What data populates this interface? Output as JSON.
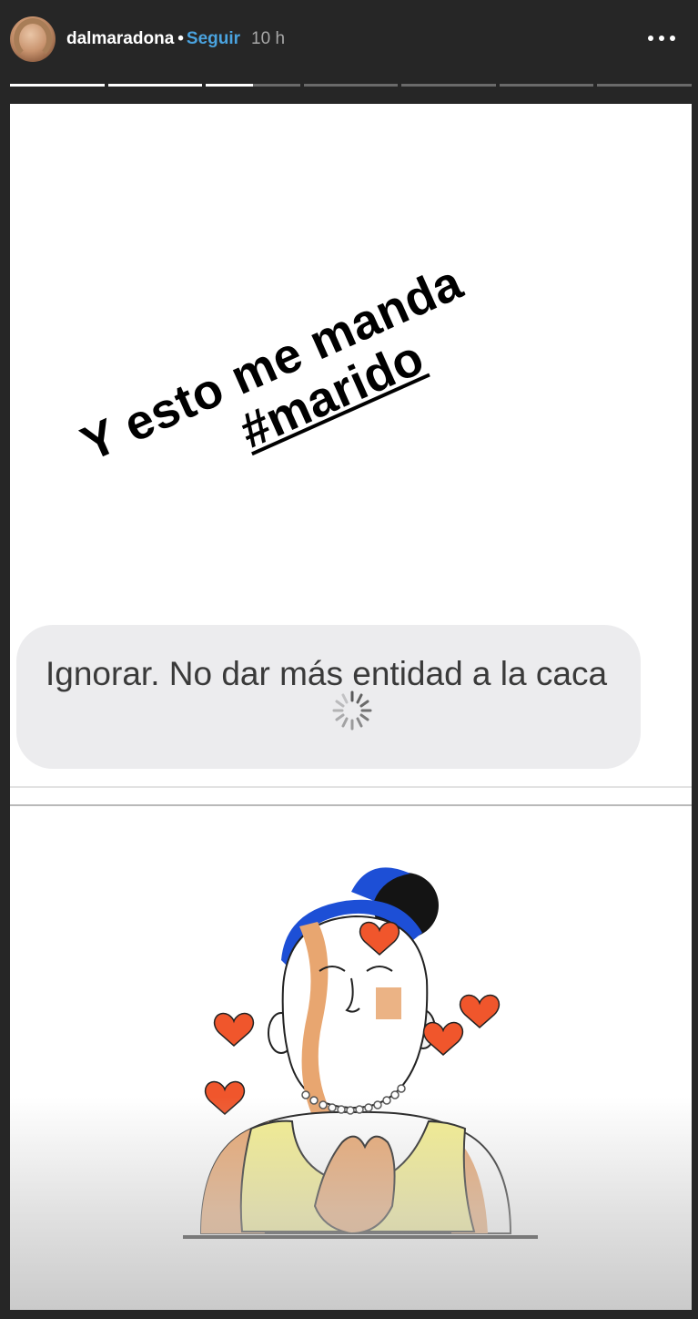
{
  "header": {
    "username": "dalmaradona",
    "separator": "•",
    "follow_label": "Seguir",
    "time": "10 h",
    "avatar_icon": "profile-avatar",
    "more_icon": "more-options-icon"
  },
  "progress": {
    "segments": 7,
    "active_index": 2,
    "active_fraction": 0.5
  },
  "story": {
    "caption_line1": "Y esto me manda",
    "caption_line2": "#marido",
    "message_text": "Ignorar. No dar más entidad a la caca",
    "loading_icon": "loading-spinner-icon",
    "illustration_icon": "woman-blowing-kisses-illustration"
  },
  "colors": {
    "background": "#262626",
    "follow": "#4aa3df",
    "bubble": "#ececee",
    "heart": "#f0562c",
    "hair": "#1d4fd6"
  }
}
